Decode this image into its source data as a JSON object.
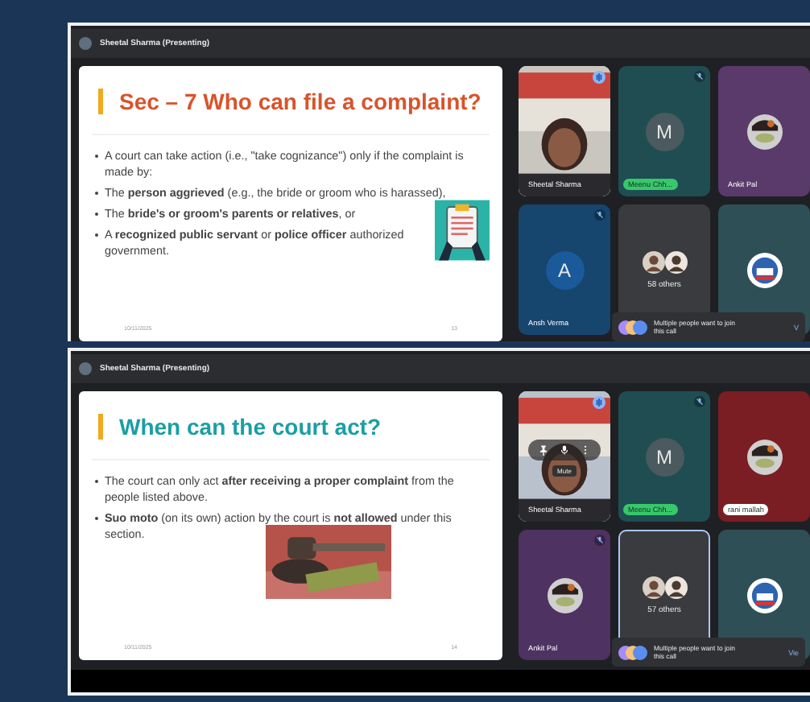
{
  "meetings": [
    {
      "presenter": "Sheetal Sharma (Presenting)",
      "slide": {
        "title": "Sec – 7  Who can file a complaint?",
        "bullets": [
          {
            "text": "A court can take action (i.e., \"take cognizance\") only if the complaint is made by:"
          },
          {
            "text": "The **person aggrieved** (e.g., the bride or groom who is harassed),"
          },
          {
            "text": "The **bride's or groom's parents or relatives**, or"
          },
          {
            "text": "A **recognized public servant** or **police officer** authorized government."
          }
        ],
        "illustration": {
          "kind": "icon"
        },
        "date": "10/11/2025",
        "page": "13"
      },
      "tiles": [
        {
          "kind": "video",
          "name": {
            "text": "Sheetal Sharma"
          },
          "color": "#c9c6c0",
          "speaking": true
        },
        {
          "kind": "avatar",
          "name": {
            "text": "Meenu Chh...",
            "color": "#37c86b"
          },
          "initial": "M",
          "color": "#1f4d52",
          "muted": true
        },
        {
          "name": {
            "text": "Ankit Pal"
          },
          "color": "#5a3a6b"
        },
        {
          "kind": "avatar",
          "name": {
            "text": "Ansh Verma"
          },
          "initial": "A",
          "color": "#16456e",
          "muted": true
        },
        {
          "kind": "others",
          "count": "58 others",
          "color": "#3a3b3e"
        },
        {
          "kind": "logo",
          "color": "#2f4f57"
        }
      ],
      "notice": {
        "text": "Multiple people want to join this call",
        "action": "V"
      }
    },
    {
      "presenter": "Sheetal Sharma (Presenting)",
      "slide": {
        "title": "When can the court act?",
        "bullets": [
          {
            "text": "The court can only act **after receiving a proper complaint** from the people listed above."
          },
          {
            "text": "**Suo moto** (on its own) action by the court is **not allowed** under this section."
          }
        ],
        "date": "10/11/2025",
        "page": "14"
      },
      "tiles": [
        {
          "kind": "video",
          "name": {
            "text": "Sheetal Sharma"
          },
          "color": "#b9c2cc",
          "speaking": true,
          "tooltip": "Mute"
        },
        {
          "kind": "avatar",
          "name": {
            "text": "Meenu Chh...",
            "color": "#37c86b"
          },
          "initial": "M",
          "color": "#1f4d52",
          "muted": true
        },
        {
          "name": {
            "text": "rani mallah",
            "color": "#ffffff"
          },
          "color": "#7a1e24"
        },
        {
          "name": {
            "text": "Ankit Pal"
          },
          "color": "#4e3261",
          "muted": true
        },
        {
          "kind": "others",
          "count": "57 others",
          "color": "#3a3b3e",
          "speaking": true
        },
        {
          "kind": "logo",
          "color": "#2f4f57"
        }
      ],
      "notice": {
        "text": "Multiple people want to join this call",
        "action": "Vie"
      }
    }
  ]
}
